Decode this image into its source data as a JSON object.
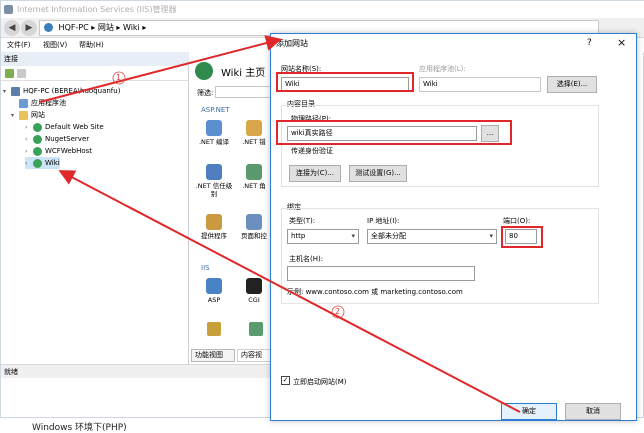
{
  "window": {
    "title": "Internet Information Services (IIS)管理器"
  },
  "address": {
    "segments": "HQF-PC  ▸  网站  ▸  Wiki  ▸"
  },
  "menu": {
    "file": "文件(F)",
    "view": "视图(V)",
    "help": "帮助(H)"
  },
  "connections": {
    "header": "连接",
    "tree": [
      {
        "label": "HQF-PC (BEREA\\huoquanfu)"
      },
      {
        "label": "应用程序池"
      },
      {
        "label": "网站"
      },
      {
        "label": "Default Web Site"
      },
      {
        "label": "NugetServer"
      },
      {
        "label": "WCFWebHost"
      },
      {
        "label": "Wiki"
      }
    ]
  },
  "content": {
    "title": "Wiki 主页",
    "filter_label": "筛选:",
    "aspnet_group": "ASP.NET",
    "iis_group": "IIS",
    "features": [
      {
        "label": ".NET 编译"
      },
      {
        "label": ".NET 错"
      },
      {
        "label": ".NET 信任级别"
      },
      {
        "label": ".NET 角"
      },
      {
        "label": "提供程序"
      },
      {
        "label": "页面和控"
      },
      {
        "label": "ASP"
      },
      {
        "label": "CGI"
      }
    ],
    "view_tab": "功能视图",
    "content_tab": "内容视"
  },
  "status": {
    "text": "就绪"
  },
  "dialog": {
    "title": "添加网站",
    "help": "?",
    "close": "×",
    "site_name_label": "网站名称(S):",
    "site_name_value": "Wiki",
    "app_pool_label": "应用程序池(L):",
    "app_pool_value": "Wiki",
    "select_button": "选择(E)...",
    "content_dir_label": "内容目录",
    "physical_path_label": "物理路径(P):",
    "physical_path_value": "wiki真实路径",
    "browse_button": "...",
    "passthrough_label": "传递身份验证",
    "connect_as_button": "连接为(C)...",
    "test_settings_button": "测试设置(G)...",
    "binding_label": "绑定",
    "type_label": "类型(T):",
    "type_value": "http",
    "ip_label": "IP 地址(I):",
    "ip_value": "全部未分配",
    "port_label": "端口(O):",
    "port_value": "80",
    "hostname_label": "主机名(H):",
    "hostname_value": "",
    "example_text": "示例: www.contoso.com 或 marketing.contoso.com",
    "start_checkbox_label": "立即启动网站(M)",
    "ok_button": "确定",
    "cancel_button": "取消"
  },
  "annotations": {
    "step1": "1",
    "step2": "2"
  },
  "bottom_text": "Windows 环境下(PHP)",
  "colors": {
    "accent": "#2a7fd4",
    "annotation_red": "#e0282b",
    "title_gray": "#b0b0b0"
  }
}
